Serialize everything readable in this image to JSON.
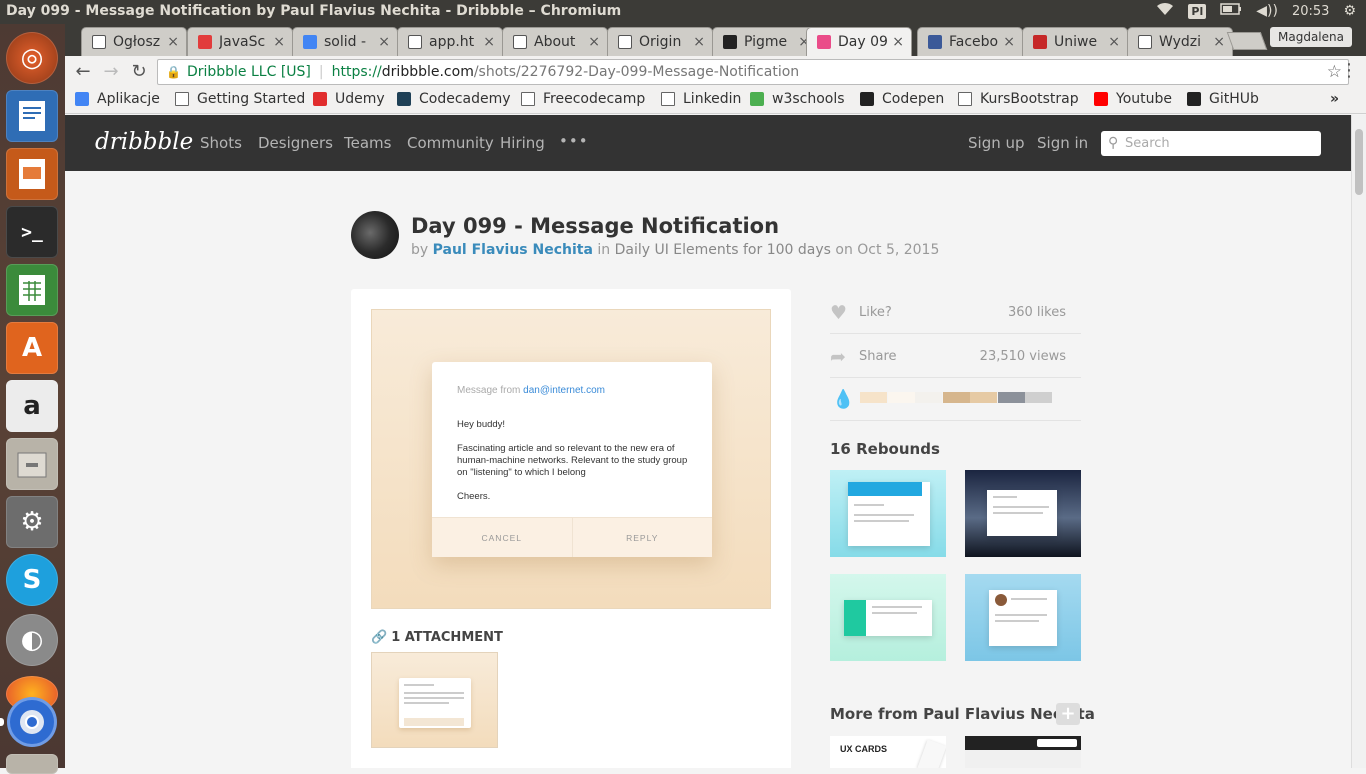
{
  "os": {
    "window_title": "Day 099 - Message Notification by Paul Flavius Nechita - Dribbble – Chromium",
    "keyboard_layout": "Pl",
    "clock": "20:53"
  },
  "launcher": {
    "items": [
      "ubuntu-dash",
      "libreoffice-writer",
      "libreoffice-impress",
      "terminal",
      "libreoffice-calc",
      "software-center",
      "amazon",
      "file-manager",
      "system-settings",
      "skype",
      "disk-usage",
      "firefox",
      "chromium",
      "files"
    ]
  },
  "browser": {
    "tabs": [
      {
        "label": "Ogłosz",
        "icon": "olx-icon",
        "color": "#ffffff"
      },
      {
        "label": "JavaSc",
        "icon": "javascript-icon",
        "color": "#e23c3c"
      },
      {
        "label": "solid -",
        "icon": "google-icon",
        "color": "#4285f4"
      },
      {
        "label": "app.ht",
        "icon": "page-icon",
        "color": "#ffffff"
      },
      {
        "label": "About",
        "icon": "page-icon",
        "color": "#ffffff"
      },
      {
        "label": "Origin",
        "icon": "page-icon",
        "color": "#ffffff"
      },
      {
        "label": "Pigme",
        "icon": "drop-icon",
        "color": "#222222"
      },
      {
        "label": "Day 09",
        "icon": "dribbble-icon",
        "color": "#ea4c89"
      },
      {
        "label": "Facebo",
        "icon": "facebook-icon",
        "color": "#3b5998"
      },
      {
        "label": "Uniwe",
        "icon": "university-icon",
        "color": "#c62828"
      },
      {
        "label": "Wydzi",
        "icon": "page-icon",
        "color": "#ffffff"
      }
    ],
    "active_tab": 7,
    "profile": "Magdalena",
    "url": {
      "org": "Dribbble LLC [US]",
      "scheme": "https://",
      "host": "dribbble.com",
      "path": "/shots/2276792-Day-099-Message-Notification"
    },
    "bookmarks": [
      {
        "label": "Aplikacje",
        "icon": "apps-icon",
        "color": "#4285f4"
      },
      {
        "label": "Getting Started",
        "icon": "page-icon",
        "color": "#ffffff"
      },
      {
        "label": "Udemy",
        "icon": "udemy-icon",
        "color": "#e12d2d"
      },
      {
        "label": "Codecademy",
        "icon": "codecademy-icon",
        "color": "#1f4056"
      },
      {
        "label": "Freecodecamp",
        "icon": "page-icon",
        "color": "#ffffff"
      },
      {
        "label": "Linkedin",
        "icon": "page-icon",
        "color": "#ffffff"
      },
      {
        "label": "w3schools",
        "icon": "w3schools-icon",
        "color": "#4caf50"
      },
      {
        "label": "Codepen",
        "icon": "codepen-icon",
        "color": "#222222"
      },
      {
        "label": "KursBootstrap",
        "icon": "page-icon",
        "color": "#ffffff"
      },
      {
        "label": "Youtube",
        "icon": "youtube-icon",
        "color": "#ff0000"
      },
      {
        "label": "GitHUb",
        "icon": "github-icon",
        "color": "#222222"
      }
    ],
    "bookmarks_overflow": "»"
  },
  "dribbble": {
    "logo": "dribbble",
    "nav": [
      "Shots",
      "Designers",
      "Teams",
      "Community",
      "Hiring"
    ],
    "more": "•••",
    "sign_up": "Sign up",
    "sign_in": "Sign in",
    "search_placeholder": "Search",
    "shot": {
      "title": "Day 099 - Message Notification",
      "by": "by",
      "author": "Paul Flavius Nechita",
      "in": "in",
      "collection": "Daily UI Elements for 100 days",
      "on": "on",
      "date": "Oct 5, 2015"
    },
    "modal": {
      "from_prefix": "Message from",
      "from_email": "dan@internet.com",
      "greeting": "Hey buddy!",
      "body": "Fascinating article and so relevant to the new era of human-machine networks. Relevant to the study group on \"listening\" to which I belong",
      "signoff": "Cheers.",
      "cancel": "CANCEL",
      "reply": "REPLY"
    },
    "attachments_label": "1 ATTACHMENT",
    "stats": {
      "like_label": "Like?",
      "likes": "360 likes",
      "share_label": "Share",
      "views": "23,510 views"
    },
    "palette": [
      "#f6e3c9",
      "#fbf6ef",
      "#f3f1ed",
      "#d6b68d",
      "#e6caa4",
      "#8c919a",
      "#cfcfcf"
    ],
    "rebounds_title": "16 Rebounds",
    "more_from": "More from Paul Flavius Nechita",
    "more_plus": "+"
  }
}
